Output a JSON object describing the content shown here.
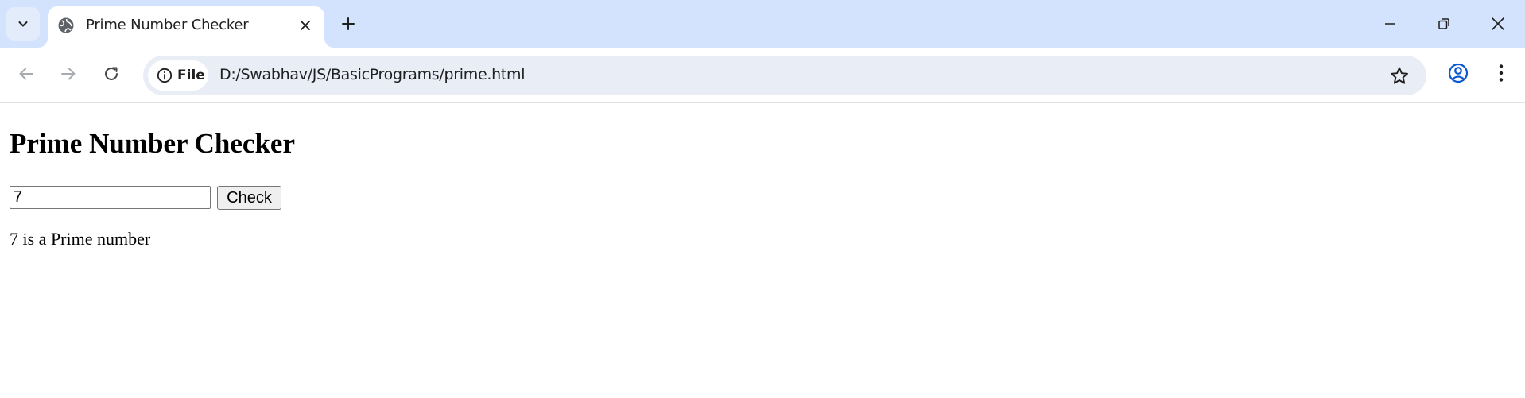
{
  "browser": {
    "tab": {
      "title": "Prime Number Checker",
      "favicon": "globe-icon"
    },
    "address_bar": {
      "site_chip_label": "File",
      "url": "D:/Swabhav/JS/BasicPrograms/prime.html"
    },
    "icons": {
      "tab_search": "chevron-down-icon",
      "new_tab": "plus-icon",
      "minimize": "minimize-icon",
      "restore": "restore-icon",
      "close": "close-icon",
      "back": "arrow-left-icon",
      "forward": "arrow-right-icon",
      "reload": "reload-icon",
      "info": "info-icon",
      "bookmark": "star-icon",
      "profile": "profile-icon",
      "menu": "more-vert-icon"
    },
    "colors": {
      "tabbar_bg": "#d3e3fd",
      "omnibox_bg": "#e9eef6",
      "profile_accent": "#0b57d0"
    }
  },
  "page": {
    "heading": "Prime Number Checker",
    "input_value": "7",
    "check_button_label": "Check",
    "result_text": "7 is a Prime number"
  }
}
